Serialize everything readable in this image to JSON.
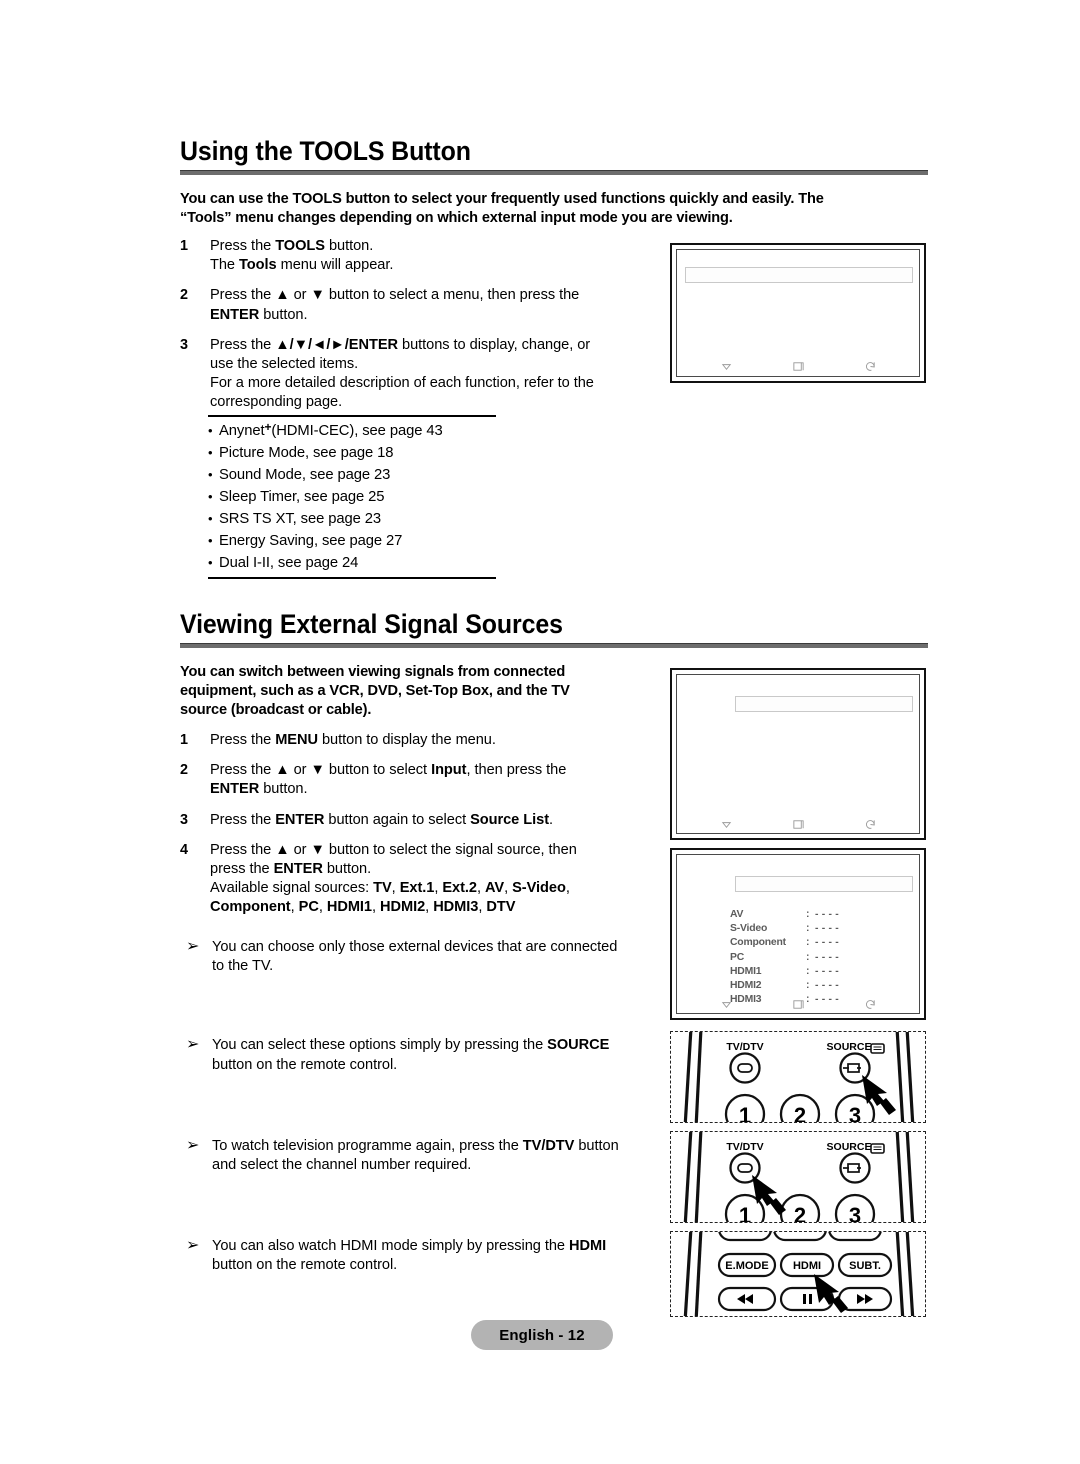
{
  "page": {
    "footer_badge": "English - 12"
  },
  "section1": {
    "heading": "Using the TOOLS Button",
    "intro_line1": "You can use the TOOLS button to select your frequently used functions quickly and easily. The",
    "intro_line2": "“Tools” menu changes depending on which external input mode you are viewing.",
    "steps": [
      {
        "num": "1",
        "parts": [
          {
            "t": "Press the ",
            "b": false
          },
          {
            "t": "TOOLS",
            "b": true
          },
          {
            "t": " button.",
            "b": false
          },
          {
            "t": "\n",
            "b": false
          },
          {
            "t": "The ",
            "b": false
          },
          {
            "t": "Tools",
            "b": true
          },
          {
            "t": " menu will appear.",
            "b": false
          }
        ]
      },
      {
        "num": "2",
        "parts": [
          {
            "t": "Press the ▲ or ▼ button to select a menu, then press the",
            "b": false
          },
          {
            "t": "\n",
            "b": false
          },
          {
            "t": "ENTER",
            "b": true
          },
          {
            "t": " button.",
            "b": false
          }
        ]
      },
      {
        "num": "3",
        "parts": [
          {
            "t": "Press the ",
            "b": false
          },
          {
            "t": "▲/▼/◄/►/ENTER",
            "b": true
          },
          {
            "t": " buttons to display, change, or",
            "b": false
          },
          {
            "t": "\n",
            "b": false
          },
          {
            "t": "use the selected items.",
            "b": false
          },
          {
            "t": "\n",
            "b": false
          },
          {
            "t": "For a more detailed description of each function, refer to the",
            "b": false
          },
          {
            "t": "\n",
            "b": false
          },
          {
            "t": "corresponding page.",
            "b": false
          }
        ]
      }
    ],
    "reference_list": [
      "Anynet⁺(HDMI-CEC), see page 43",
      "Picture Mode, see page 18",
      "Sound Mode, see page 23",
      "Sleep Timer, see page 25",
      "SRS TS XT, see page 23",
      "Energy Saving, see page 27",
      "Dual I-II, see page 24"
    ]
  },
  "section2": {
    "heading": "Viewing External Signal Sources",
    "intro_line1": "You can switch between viewing signals from connected",
    "intro_line2": "equipment, such as a VCR, DVD, Set-Top Box, and the TV",
    "intro_line3": "source (broadcast or cable).",
    "steps": [
      {
        "num": "1",
        "parts": [
          {
            "t": "Press the ",
            "b": false
          },
          {
            "t": "MENU",
            "b": true
          },
          {
            "t": " button to display the menu.",
            "b": false
          }
        ]
      },
      {
        "num": "2",
        "parts": [
          {
            "t": "Press the ▲ or ▼ button to select ",
            "b": false
          },
          {
            "t": "Input",
            "b": true
          },
          {
            "t": ", then press the",
            "b": false
          },
          {
            "t": "\n",
            "b": false
          },
          {
            "t": "ENTER",
            "b": true
          },
          {
            "t": " button.",
            "b": false
          }
        ]
      },
      {
        "num": "3",
        "parts": [
          {
            "t": "Press the ",
            "b": false
          },
          {
            "t": "ENTER",
            "b": true
          },
          {
            "t": " button again to select ",
            "b": false
          },
          {
            "t": "Source List",
            "b": true
          },
          {
            "t": ".",
            "b": false
          }
        ]
      },
      {
        "num": "4",
        "parts": [
          {
            "t": "Press the ▲ or ▼ button to select the signal source, then",
            "b": false
          },
          {
            "t": "\n",
            "b": false
          },
          {
            "t": "press the ",
            "b": false
          },
          {
            "t": "ENTER",
            "b": true
          },
          {
            "t": " button.",
            "b": false
          },
          {
            "t": "\n",
            "b": false
          },
          {
            "t": "Available signal sources: ",
            "b": false
          },
          {
            "t": "TV",
            "b": true
          },
          {
            "t": ", ",
            "b": false
          },
          {
            "t": "Ext.1",
            "b": true
          },
          {
            "t": ", ",
            "b": false
          },
          {
            "t": "Ext.2",
            "b": true
          },
          {
            "t": ", ",
            "b": false
          },
          {
            "t": "AV",
            "b": true
          },
          {
            "t": ", ",
            "b": false
          },
          {
            "t": "S-Video",
            "b": true
          },
          {
            "t": ",",
            "b": false
          },
          {
            "t": "\n",
            "b": false
          },
          {
            "t": "Component",
            "b": true
          },
          {
            "t": ", ",
            "b": false
          },
          {
            "t": "PC",
            "b": true
          },
          {
            "t": ", ",
            "b": false
          },
          {
            "t": "HDMI1",
            "b": true
          },
          {
            "t": ", ",
            "b": false
          },
          {
            "t": "HDMI2",
            "b": true
          },
          {
            "t": ", ",
            "b": false
          },
          {
            "t": "HDMI3",
            "b": true
          },
          {
            "t": ", ",
            "b": false
          },
          {
            "t": "DTV",
            "b": true
          }
        ]
      }
    ],
    "notes": [
      {
        "arrow": "➢",
        "parts": [
          {
            "t": "You can choose only those external devices that are connected",
            "b": false
          },
          {
            "t": "\n",
            "b": false
          },
          {
            "t": "to the TV.",
            "b": false
          }
        ]
      },
      {
        "arrow": "➢",
        "parts": [
          {
            "t": "You can select these options simply by pressing the ",
            "b": false
          },
          {
            "t": "SOURCE",
            "b": true
          },
          {
            "t": "\n",
            "b": false
          },
          {
            "t": "button on the remote control.",
            "b": false
          }
        ]
      },
      {
        "arrow": "➢",
        "parts": [
          {
            "t": "To watch television programme again, press the ",
            "b": false
          },
          {
            "t": "TV/DTV",
            "b": true
          },
          {
            "t": " button",
            "b": false
          },
          {
            "t": "\n",
            "b": false
          },
          {
            "t": "and select the channel number required.",
            "b": false
          }
        ]
      },
      {
        "arrow": "➢",
        "parts": [
          {
            "t": "You can also watch HDMI mode simply by pressing the ",
            "b": false
          },
          {
            "t": "HDMI",
            "b": true
          },
          {
            "t": "\n",
            "b": false
          },
          {
            "t": "button on the remote control.",
            "b": false
          }
        ]
      }
    ]
  },
  "tv_screens": [
    {
      "name": "tools-menu-screen",
      "titlebar": true,
      "source_list": [],
      "icons": [
        "move-icon",
        "enter-icon",
        "return-icon"
      ]
    },
    {
      "name": "input-menu-screen",
      "titlebar": true,
      "source_list": [],
      "icons": [
        "move-icon",
        "enter-icon",
        "return-icon"
      ]
    },
    {
      "name": "source-list-screen",
      "titlebar": true,
      "source_list": [
        {
          "label": "AV",
          "value": "- - - -"
        },
        {
          "label": "S-Video",
          "value": "- - - -"
        },
        {
          "label": "Component",
          "value": "- - - -"
        },
        {
          "label": "PC",
          "value": "- - - -"
        },
        {
          "label": "HDMI1",
          "value": "- - - -"
        },
        {
          "label": "HDMI2",
          "value": "- - - -"
        },
        {
          "label": "HDMI3",
          "value": "- - - -"
        }
      ],
      "icons": [
        "move-icon",
        "enter-icon",
        "return-icon"
      ]
    }
  ],
  "remotes": [
    {
      "name": "remote-source",
      "buttons": [
        "TV/DTV",
        "SOURCE",
        "1",
        "2",
        "3"
      ],
      "highlighted": "SOURCE"
    },
    {
      "name": "remote-tvdtv",
      "buttons": [
        "TV/DTV",
        "SOURCE",
        "1",
        "2",
        "3"
      ],
      "highlighted": "TV/DTV"
    },
    {
      "name": "remote-hdmi",
      "buttons": [
        "E.MODE",
        "HDMI",
        "SUBT."
      ],
      "highlighted": "HDMI"
    }
  ],
  "colors": {
    "rule": "#6d6d6d",
    "badge_bg": "#b3b3b3",
    "screen_border": "#111111",
    "srclist_text": "#5c5c5c"
  }
}
